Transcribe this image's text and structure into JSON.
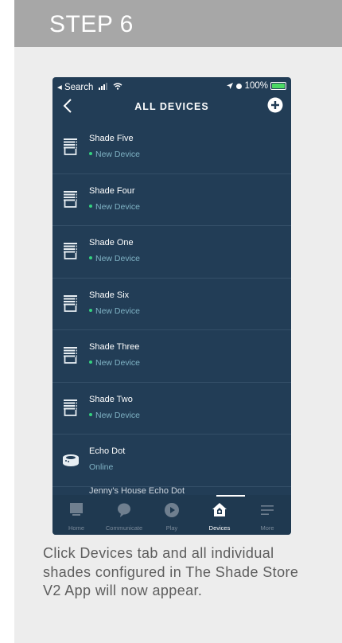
{
  "step": {
    "title": "STEP 6"
  },
  "status_bar": {
    "back_app": "◂ Search",
    "battery_pct": "100%"
  },
  "nav": {
    "title": "ALL DEVICES"
  },
  "devices": [
    {
      "name": "Shade Five",
      "status": "New Device",
      "kind": "shade"
    },
    {
      "name": "Shade Four",
      "status": "New Device",
      "kind": "shade"
    },
    {
      "name": "Shade One",
      "status": "New Device",
      "kind": "shade"
    },
    {
      "name": "Shade Six",
      "status": "New Device",
      "kind": "shade"
    },
    {
      "name": "Shade Three",
      "status": "New Device",
      "kind": "shade"
    },
    {
      "name": "Shade Two",
      "status": "New Device",
      "kind": "shade"
    },
    {
      "name": "Echo Dot",
      "status": "Online",
      "kind": "echo"
    }
  ],
  "partial_device": "Jenny's House Echo Dot",
  "tabs": [
    {
      "label": "Home",
      "icon": "home-icon"
    },
    {
      "label": "Communicate",
      "icon": "chat-bubble-icon"
    },
    {
      "label": "Play",
      "icon": "play-icon"
    },
    {
      "label": "Devices",
      "icon": "devices-house-icon",
      "active": true
    },
    {
      "label": "More",
      "icon": "menu-lines-icon"
    }
  ],
  "caption": "Click Devices tab and all individual shades configured in The Shade Store V2 App will now appear.",
  "colors": {
    "header": "#a7a7a7",
    "card": "#ededed",
    "app_bg": "#223d56",
    "accent_green": "#34d17f",
    "status_text": "#7fb2c4"
  }
}
